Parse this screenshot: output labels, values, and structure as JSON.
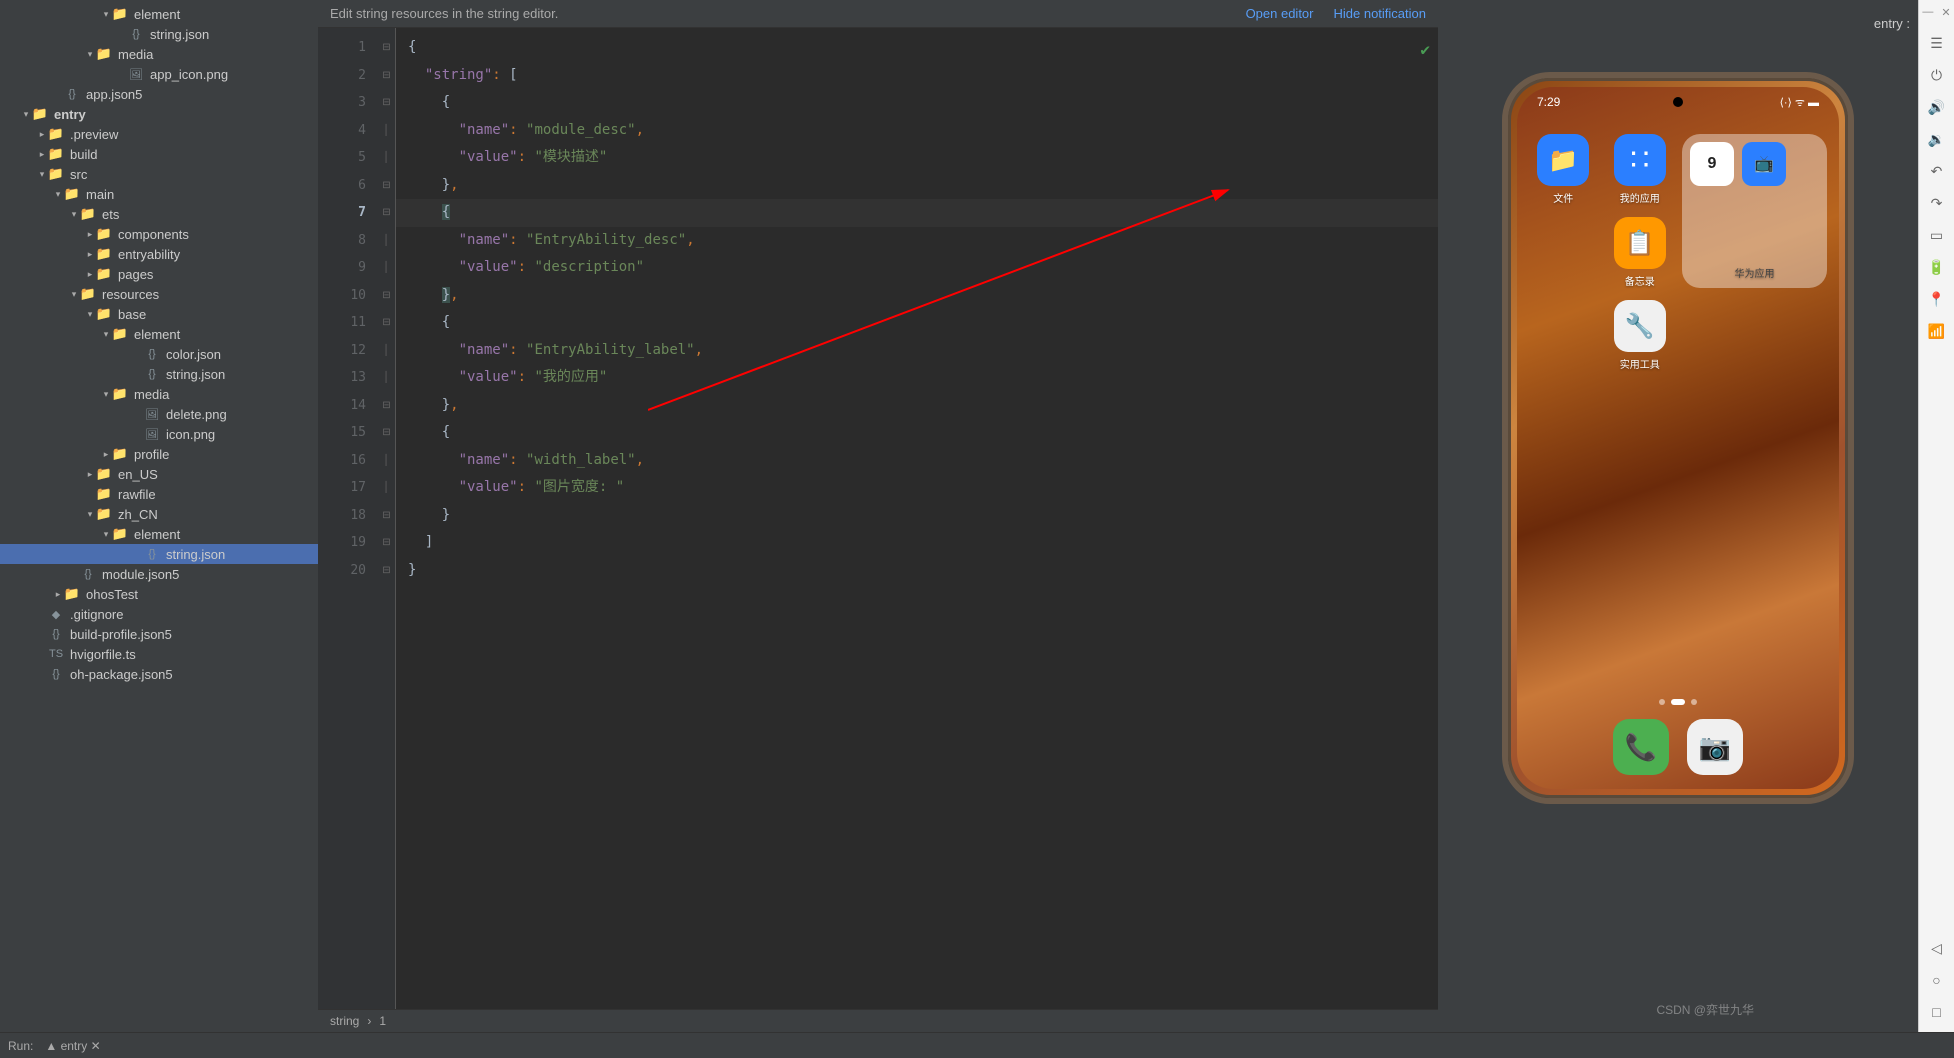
{
  "tree": {
    "items": [
      {
        "depth": 5,
        "arrow": "▾",
        "icon": "folder",
        "label": "element"
      },
      {
        "depth": 6,
        "arrow": "",
        "icon": "file-json",
        "label": "string.json"
      },
      {
        "depth": 4,
        "arrow": "▾",
        "icon": "folder",
        "label": "media"
      },
      {
        "depth": 6,
        "arrow": "",
        "icon": "file-img",
        "label": "app_icon.png"
      },
      {
        "depth": 2,
        "arrow": "",
        "icon": "file-json",
        "label": "app.json5"
      },
      {
        "depth": 0,
        "arrow": "▾",
        "icon": "folder-blue",
        "label": "entry",
        "bold": true
      },
      {
        "depth": 1,
        "arrow": "▸",
        "icon": "folder-orange",
        "label": ".preview"
      },
      {
        "depth": 1,
        "arrow": "▸",
        "icon": "folder-orange",
        "label": "build"
      },
      {
        "depth": 1,
        "arrow": "▾",
        "icon": "folder",
        "label": "src"
      },
      {
        "depth": 2,
        "arrow": "▾",
        "icon": "folder",
        "label": "main"
      },
      {
        "depth": 3,
        "arrow": "▾",
        "icon": "folder",
        "label": "ets"
      },
      {
        "depth": 4,
        "arrow": "▸",
        "icon": "folder",
        "label": "components"
      },
      {
        "depth": 4,
        "arrow": "▸",
        "icon": "folder",
        "label": "entryability"
      },
      {
        "depth": 4,
        "arrow": "▸",
        "icon": "folder",
        "label": "pages"
      },
      {
        "depth": 3,
        "arrow": "▾",
        "icon": "folder",
        "label": "resources"
      },
      {
        "depth": 4,
        "arrow": "▾",
        "icon": "folder",
        "label": "base"
      },
      {
        "depth": 5,
        "arrow": "▾",
        "icon": "folder",
        "label": "element"
      },
      {
        "depth": 7,
        "arrow": "",
        "icon": "file-json",
        "label": "color.json"
      },
      {
        "depth": 7,
        "arrow": "",
        "icon": "file-json",
        "label": "string.json"
      },
      {
        "depth": 5,
        "arrow": "▾",
        "icon": "folder",
        "label": "media"
      },
      {
        "depth": 7,
        "arrow": "",
        "icon": "file-img",
        "label": "delete.png"
      },
      {
        "depth": 7,
        "arrow": "",
        "icon": "file-img",
        "label": "icon.png"
      },
      {
        "depth": 5,
        "arrow": "▸",
        "icon": "folder",
        "label": "profile"
      },
      {
        "depth": 4,
        "arrow": "▸",
        "icon": "folder",
        "label": "en_US"
      },
      {
        "depth": 4,
        "arrow": "",
        "icon": "folder",
        "label": "rawfile"
      },
      {
        "depth": 4,
        "arrow": "▾",
        "icon": "folder",
        "label": "zh_CN"
      },
      {
        "depth": 5,
        "arrow": "▾",
        "icon": "folder",
        "label": "element"
      },
      {
        "depth": 7,
        "arrow": "",
        "icon": "file-json",
        "label": "string.json",
        "selected": true
      },
      {
        "depth": 3,
        "arrow": "",
        "icon": "file-json",
        "label": "module.json5"
      },
      {
        "depth": 2,
        "arrow": "▸",
        "icon": "folder",
        "label": "ohosTest"
      },
      {
        "depth": 1,
        "arrow": "",
        "icon": "file",
        "label": ".gitignore"
      },
      {
        "depth": 1,
        "arrow": "",
        "icon": "file-json",
        "label": "build-profile.json5"
      },
      {
        "depth": 1,
        "arrow": "",
        "icon": "file-ts",
        "label": "hvigorfile.ts"
      },
      {
        "depth": 1,
        "arrow": "",
        "icon": "file-json",
        "label": "oh-package.json5"
      }
    ]
  },
  "banner": {
    "message": "Edit string resources in the string editor.",
    "open_editor": "Open editor",
    "hide_notification": "Hide notification"
  },
  "code": {
    "lines": [
      {
        "n": 1,
        "html": "<span class='tok-brace'>{</span>"
      },
      {
        "n": 2,
        "html": "  <span class='tok-key'>\"string\"</span><span class='tok-punct'>:</span> <span class='tok-brace'>[</span>"
      },
      {
        "n": 3,
        "html": "    <span class='tok-brace'>{</span>"
      },
      {
        "n": 4,
        "html": "      <span class='tok-key'>\"name\"</span><span class='tok-punct'>:</span> <span class='tok-str'>\"module_desc\"</span><span class='tok-punct'>,</span>"
      },
      {
        "n": 5,
        "html": "      <span class='tok-key'>\"value\"</span><span class='tok-punct'>:</span> <span class='tok-str'>\"模块描述\"</span>"
      },
      {
        "n": 6,
        "html": "    <span class='tok-brace'>}</span><span class='tok-punct'>,</span>"
      },
      {
        "n": 7,
        "html": "    <span class='tok-brace tok-brace-hl'>{</span>",
        "highlight": true,
        "bulb": true
      },
      {
        "n": 8,
        "html": "      <span class='tok-key'>\"name\"</span><span class='tok-punct'>:</span> <span class='tok-str'>\"EntryAbility_desc\"</span><span class='tok-punct'>,</span>"
      },
      {
        "n": 9,
        "html": "      <span class='tok-key'>\"value\"</span><span class='tok-punct'>:</span> <span class='tok-str'>\"description\"</span>"
      },
      {
        "n": 10,
        "html": "    <span class='tok-brace tok-brace-hl'>}</span><span class='tok-punct'>,</span>"
      },
      {
        "n": 11,
        "html": "    <span class='tok-brace'>{</span>"
      },
      {
        "n": 12,
        "html": "      <span class='tok-key'>\"name\"</span><span class='tok-punct'>:</span> <span class='tok-str'>\"EntryAbility_label\"</span><span class='tok-punct'>,</span>"
      },
      {
        "n": 13,
        "html": "      <span class='tok-key'>\"value\"</span><span class='tok-punct'>:</span> <span class='tok-str'>\"我的应用\"</span>"
      },
      {
        "n": 14,
        "html": "    <span class='tok-brace'>}</span><span class='tok-punct'>,</span>"
      },
      {
        "n": 15,
        "html": "    <span class='tok-brace'>{</span>"
      },
      {
        "n": 16,
        "html": "      <span class='tok-key'>\"name\"</span><span class='tok-punct'>:</span> <span class='tok-str'>\"width_label\"</span><span class='tok-punct'>,</span>"
      },
      {
        "n": 17,
        "html": "      <span class='tok-key'>\"value\"</span><span class='tok-punct'>:</span> <span class='tok-str'>\"图片宽度: \"</span>"
      },
      {
        "n": 18,
        "html": "    <span class='tok-brace'>}</span>"
      },
      {
        "n": 19,
        "html": "  <span class='tok-brace'>]</span>"
      },
      {
        "n": 20,
        "html": "<span class='tok-brace'>}</span>"
      }
    ]
  },
  "breadcrumb": {
    "item1": "string",
    "item2": "1"
  },
  "preview": {
    "entry_label": "entry :",
    "status_time": "7:29",
    "status_icons": "⟨·⟩ ᯤ ▬",
    "apps": [
      {
        "label": "文件",
        "bg": "#2b7fff",
        "glyph": "📁"
      },
      {
        "label": "我的应用",
        "bg": "#2b7fff",
        "glyph": "∷"
      },
      {
        "label": "备忘录",
        "bg": "#ff9800",
        "glyph": "📋"
      },
      {
        "label": "实用工具",
        "bg": "#f0f0f0",
        "glyph": "🔧"
      }
    ],
    "widget_label": "华为应用",
    "widget_date": "9",
    "dock": [
      {
        "bg": "#4caf50",
        "glyph": "📞"
      },
      {
        "bg": "#f0f0f0",
        "glyph": "📷"
      }
    ]
  },
  "bottom": {
    "run_label": "Run:",
    "run_config": "entry"
  },
  "watermark": "CSDN @弈世九华"
}
